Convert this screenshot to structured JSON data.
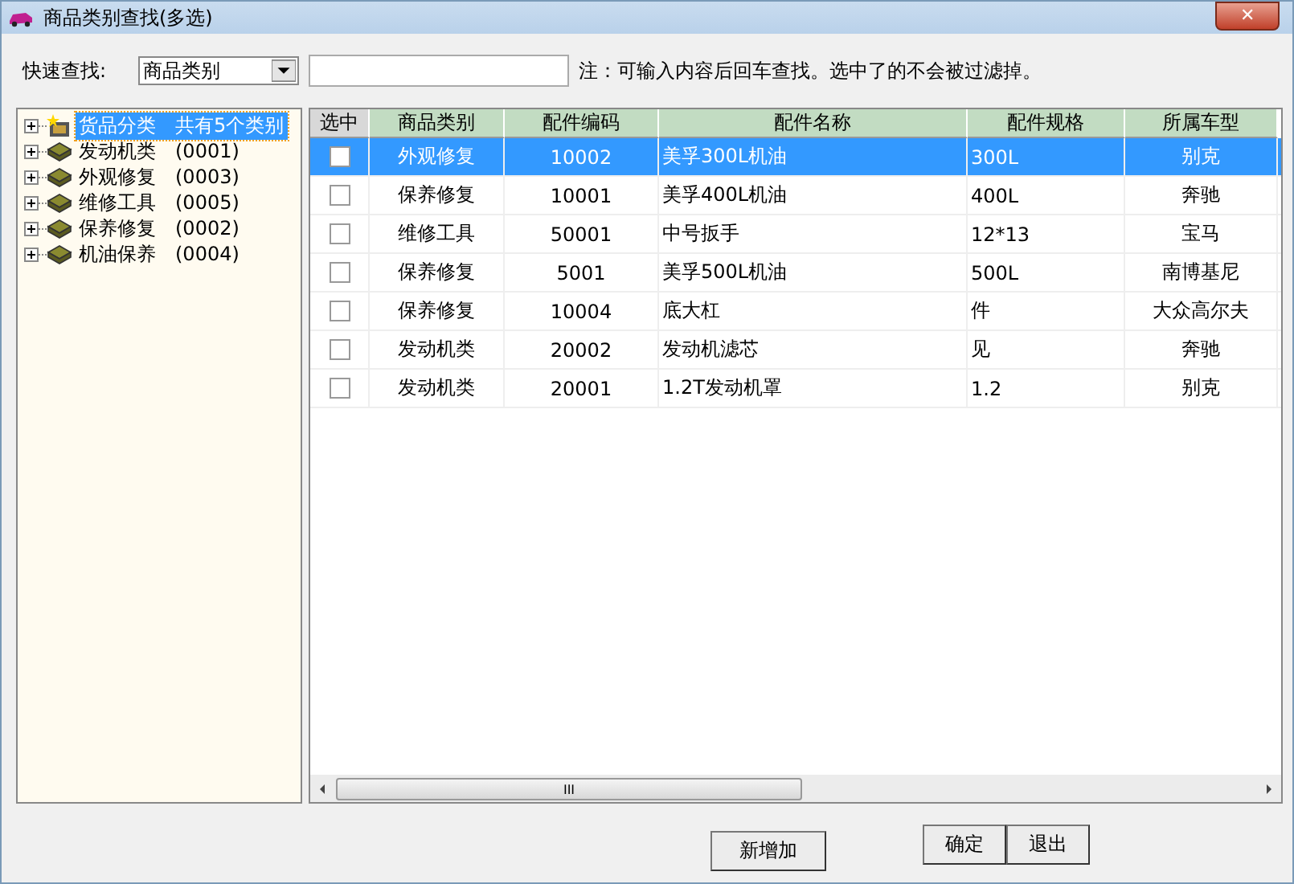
{
  "window": {
    "title": "商品类别查找(多选)",
    "close": "✕"
  },
  "search": {
    "label": "快速查找:",
    "field": "商品类别",
    "note": "注：可输入内容后回车查找。选中了的不会被过滤掉。"
  },
  "tree": [
    {
      "label": "货品分类　共有5个类别",
      "kind": "root",
      "selected": true,
      "expanded": false
    },
    {
      "label": "发动机类　(0001)",
      "kind": "book",
      "selected": false,
      "expanded": false
    },
    {
      "label": "外观修复　(0003)",
      "kind": "book",
      "selected": false,
      "expanded": false
    },
    {
      "label": "维修工具　(0005)",
      "kind": "book",
      "selected": false,
      "expanded": false
    },
    {
      "label": "保养修复　(0002)",
      "kind": "book",
      "selected": false,
      "expanded": false
    },
    {
      "label": "机油保养　(0004)",
      "kind": "book",
      "selected": false,
      "expanded": false
    }
  ],
  "table": {
    "check_column": "选中",
    "columns": [
      "商品类别",
      "配件编码",
      "配件名称",
      "配件规格",
      "所属车型"
    ],
    "rows": [
      {
        "selected": true,
        "checked": false,
        "cells": [
          "外观修复",
          "10002",
          "美孚300L机油",
          "300L",
          "别克"
        ]
      },
      {
        "selected": false,
        "checked": false,
        "cells": [
          "保养修复",
          "10001",
          "美孚400L机油",
          "400L",
          "奔驰"
        ]
      },
      {
        "selected": false,
        "checked": false,
        "cells": [
          "维修工具",
          "50001",
          "中号扳手",
          "12*13",
          "宝马"
        ]
      },
      {
        "selected": false,
        "checked": false,
        "cells": [
          "保养修复",
          "5001",
          "美孚500L机油",
          "500L",
          "南博基尼"
        ]
      },
      {
        "selected": false,
        "checked": false,
        "cells": [
          "保养修复",
          "10004",
          "底大杠",
          "件",
          "大众高尔夫"
        ]
      },
      {
        "selected": false,
        "checked": false,
        "cells": [
          "发动机类",
          "20002",
          "发动机滤芯",
          "见",
          "奔驰"
        ]
      },
      {
        "selected": false,
        "checked": false,
        "cells": [
          "发动机类",
          "20001",
          "1.2T发动机罩",
          "1.2",
          "别克"
        ]
      }
    ]
  },
  "scrollbar": {
    "thumb": "III"
  },
  "buttons": {
    "add": "新增加",
    "ok": "确定",
    "exit": "退出"
  }
}
